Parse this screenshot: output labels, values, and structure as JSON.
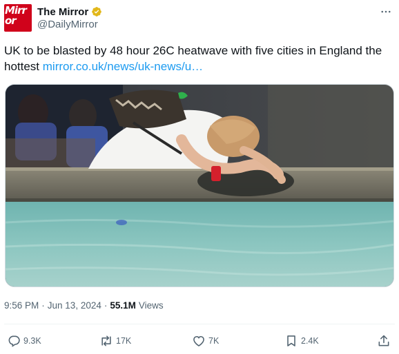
{
  "account": {
    "display_name": "The Mirror",
    "handle": "@DailyMirror",
    "avatar_text_line1": "Mirr",
    "avatar_text_line2": "or"
  },
  "tweet": {
    "text": "UK to be blasted by 48 hour 26C heatwave with five cities in England the hottest ",
    "link_text": "mirror.co.uk/news/uk-news/u…"
  },
  "meta": {
    "time": "9:56 PM",
    "separator": "·",
    "date": "Jun 13, 2024",
    "views_count": "55.1M",
    "views_label": "Views"
  },
  "actions": {
    "replies": "9.3K",
    "reposts": "17K",
    "likes": "7K",
    "bookmarks": "2.4K"
  },
  "icons": {
    "verified": "verified-badge-icon",
    "more": "more-icon",
    "reply": "reply-icon",
    "repost": "repost-icon",
    "like": "heart-icon",
    "bookmark": "bookmark-icon",
    "share": "share-icon"
  },
  "colors": {
    "brand_red": "#d0021b",
    "link": "#1d9bf0",
    "secondary_text": "#536471",
    "verified_gold": "#e2b719"
  }
}
